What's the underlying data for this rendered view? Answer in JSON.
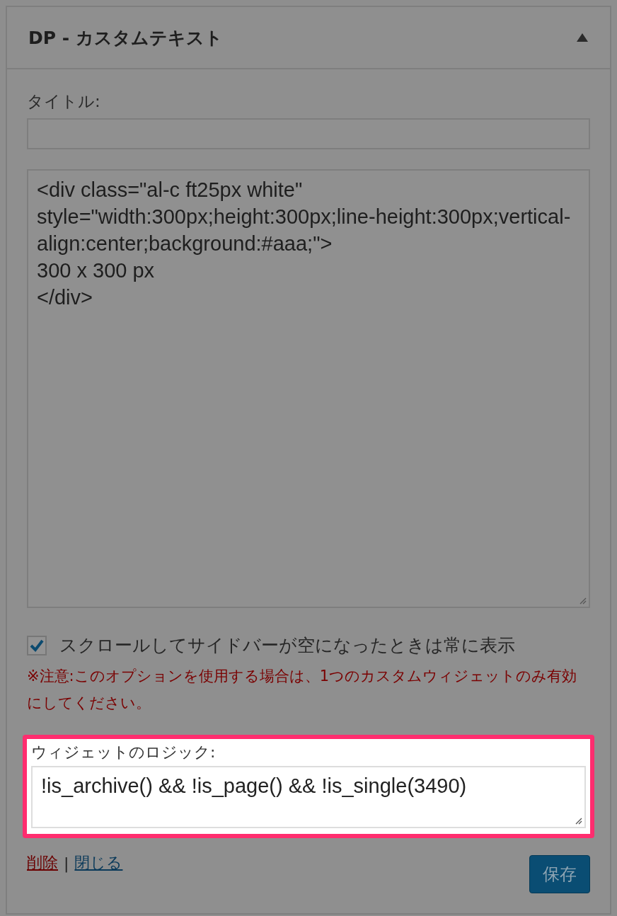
{
  "widget": {
    "title": "DP - カスタムテキスト",
    "expanded": true
  },
  "title_field": {
    "label": "タイトル:"
  },
  "content_field": {
    "value": "<div class=\"al-c ft25px white\"\nstyle=\"width:300px;height:300px;line-height:300px;vertical-align:center;background:#aaa;\">\n300 x 300 px\n</div>"
  },
  "sticky_option": {
    "label": "スクロールしてサイドバーが空になったときは常に表示",
    "checked": true
  },
  "notice": "※注意:このオプションを使用する場合は、1つのカスタムウィジェットのみ有効にしてください。",
  "logic_field": {
    "label": "ウィジェットのロジック:",
    "value": "!is_archive() && !is_page() && !is_single(3490)"
  },
  "actions": {
    "delete": "削除",
    "separator": "|",
    "close": "閉じる",
    "save": "保存"
  }
}
